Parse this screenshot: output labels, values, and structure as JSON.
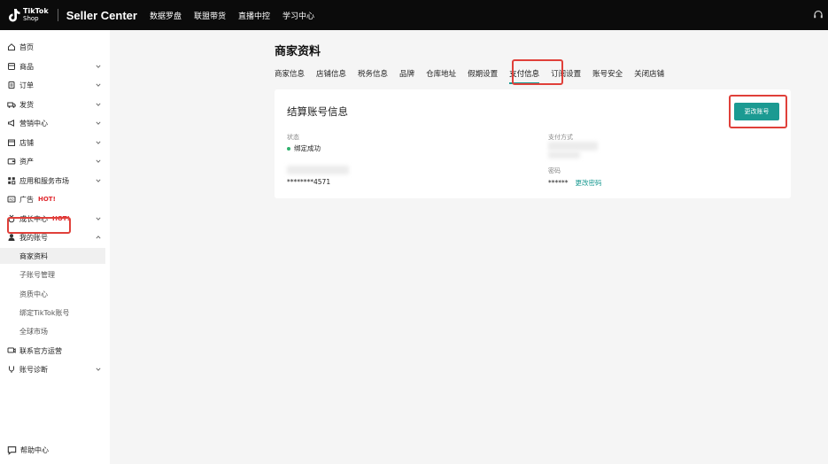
{
  "header": {
    "logo_line1": "TikTok",
    "logo_line2": "Shop",
    "brand": "Seller Center",
    "nav": [
      "数据罗盘",
      "联盟带货",
      "直播中控",
      "学习中心"
    ]
  },
  "sidebar": {
    "items": [
      {
        "label": "首页",
        "icon": "home-icon"
      },
      {
        "label": "商品",
        "icon": "product-icon"
      },
      {
        "label": "订单",
        "icon": "order-icon"
      },
      {
        "label": "发货",
        "icon": "shipping-icon"
      },
      {
        "label": "营销中心",
        "icon": "megaphone-icon"
      },
      {
        "label": "店铺",
        "icon": "store-icon"
      },
      {
        "label": "资产",
        "icon": "wallet-icon"
      },
      {
        "label": "应用和服务市场",
        "icon": "apps-icon"
      },
      {
        "label": "广告",
        "icon": "ad-icon",
        "badge": "HOT!"
      },
      {
        "label": "成长中心",
        "icon": "medal-icon",
        "badge": "HOT!"
      },
      {
        "label": "我的账号",
        "icon": "user-icon"
      }
    ],
    "sub_items": [
      "商家资料",
      "子账号管理",
      "资质中心",
      "绑定TikTok账号",
      "全球市场"
    ],
    "bottom_items": [
      {
        "label": "联系官方运营",
        "icon": "contact-icon"
      },
      {
        "label": "账号诊断",
        "icon": "diagnosis-icon"
      }
    ],
    "help": "帮助中心"
  },
  "main": {
    "title": "商家资料",
    "tabs": [
      "商家信息",
      "店铺信息",
      "税务信息",
      "品牌",
      "仓库地址",
      "假期设置",
      "支付信息",
      "订阅设置",
      "账号安全",
      "关闭店铺"
    ],
    "active_tab": "支付信息"
  },
  "card": {
    "title": "结算账号信息",
    "change_button": "更改账号",
    "status_label": "状态",
    "status_value": "绑定成功",
    "payment_method_label": "支付方式",
    "account_number": "********4571",
    "password_label": "密码",
    "password_value": "******",
    "change_password_link": "更改密码"
  },
  "colors": {
    "accent": "#1b9a92",
    "highlight": "#e0403a",
    "status_ok": "#2fb16d",
    "hot": "#e0282e"
  }
}
